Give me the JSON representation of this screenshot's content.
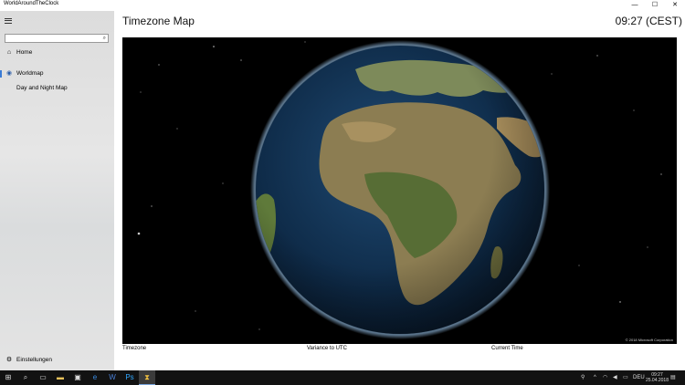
{
  "window": {
    "title": "WorldAroundTheClock",
    "controls": [
      "—",
      "☐",
      "✕"
    ]
  },
  "sidebar": {
    "search_placeholder": "",
    "items": [
      {
        "label": "Home",
        "icon": "home-icon",
        "glyph": "⌂"
      },
      {
        "label": "Worldmap",
        "icon": "globe-icon",
        "glyph": "◉"
      },
      {
        "label": "Day and Night Map",
        "icon": "",
        "glyph": ""
      }
    ],
    "settings": {
      "label": "Einstellungen",
      "icon": "gear-icon",
      "glyph": "⚙"
    }
  },
  "header": {
    "title": "Timezone Map",
    "time": "09:27 (CEST)"
  },
  "map": {
    "copyright": "© 2018 Microsoft Corporation"
  },
  "columns": [
    "Timezone",
    "Variance to UTC",
    "Current Time"
  ],
  "taskbar": {
    "tray_language": "DEU",
    "clock_time": "09:27",
    "clock_date": "25.04.2018"
  },
  "colors": {
    "accent": "#3a7bd5",
    "taskbar": "#121212",
    "space": "#000000",
    "ocean": "#0e2a47"
  }
}
